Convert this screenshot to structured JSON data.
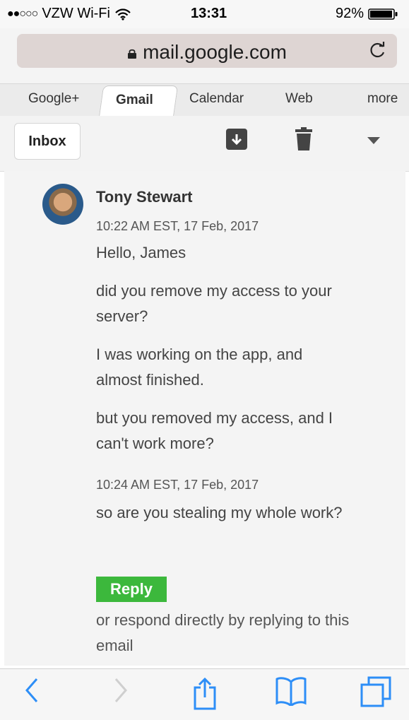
{
  "status_bar": {
    "signal_dots": "●●○○○",
    "carrier": "VZW Wi-Fi",
    "time": "13:31",
    "battery_percent": "92%",
    "icons": [
      "wifi-icon",
      "battery-icon"
    ]
  },
  "browser": {
    "url": "mail.google.com",
    "icons": [
      "lock-icon",
      "reload-icon"
    ]
  },
  "tabs": [
    {
      "label": "Google+"
    },
    {
      "label": "Gmail",
      "active": true
    },
    {
      "label": "Calendar"
    },
    {
      "label": "Web"
    },
    {
      "label": "more"
    }
  ],
  "toolbar": {
    "inbox_label": "Inbox",
    "icons": [
      "archive-icon",
      "trash-icon",
      "dropdown-icon"
    ]
  },
  "email": {
    "sender": "Tony Stewart",
    "timestamp1": "10:22 AM EST, 17 Feb, 2017",
    "greeting": "Hello, James",
    "para1": "did you remove my access to your server?",
    "para2": "I was working on the app, and almost finished.",
    "para3": "but you removed my access, and I can't work more?",
    "timestamp2": "10:24 AM EST, 17 Feb, 2017",
    "para4": "so are you stealing my whole work?",
    "reply_label": "Reply",
    "footer_note": "or respond directly by replying to this email"
  },
  "bottom_bar": {
    "icons": [
      "back-icon",
      "forward-icon",
      "share-icon",
      "bookmarks-icon",
      "tabs-icon"
    ]
  },
  "colors": {
    "reply_green": "#3cb83c",
    "ios_blue": "#2d8ef7",
    "url_field": "#ded5d3"
  }
}
